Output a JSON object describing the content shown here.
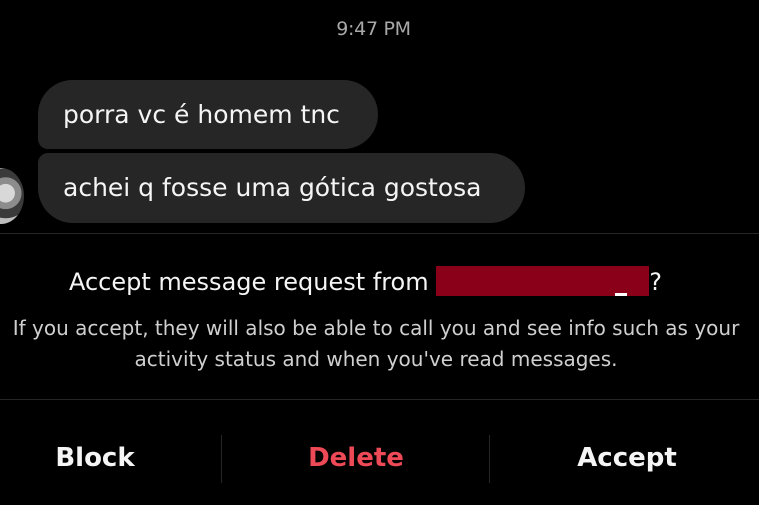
{
  "thread": {
    "timestamp": "9:47 PM",
    "messages": [
      {
        "text": "porra vc é homem tnc"
      },
      {
        "text": "achei q fosse uma gótica gostosa"
      }
    ]
  },
  "request": {
    "title_prefix": "Accept message request from ",
    "title_suffix": "?",
    "description": "If you accept, they will also be able to call you and see info such as your activity status and when you've read messages."
  },
  "actions": {
    "block_label": "Block",
    "delete_label": "Delete",
    "accept_label": "Accept"
  },
  "colors": {
    "background": "#000000",
    "bubble": "#262626",
    "delete": "#ed4956",
    "redaction": "#8a0018",
    "muted_text": "#a8a8a8"
  }
}
